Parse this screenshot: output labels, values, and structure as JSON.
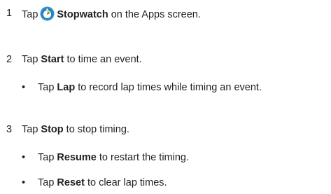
{
  "steps": [
    {
      "number": "1",
      "pre": "Tap",
      "icon": "stopwatch-app-icon",
      "bold": "Stopwatch",
      "post": " on the Apps screen.",
      "subs": []
    },
    {
      "number": "2",
      "pre": "Tap ",
      "bold": "Start",
      "post": " to time an event.",
      "subs": [
        {
          "bullet": "•",
          "pre": "Tap ",
          "bold": "Lap",
          "post": " to record lap times while timing an event."
        }
      ]
    },
    {
      "number": "3",
      "pre": "Tap ",
      "bold": "Stop",
      "post": " to stop timing.",
      "subs": [
        {
          "bullet": "•",
          "pre": "Tap ",
          "bold": "Resume",
          "post": " to restart the timing."
        },
        {
          "bullet": "•",
          "pre": "Tap ",
          "bold": "Reset",
          "post": " to clear lap times."
        }
      ]
    }
  ],
  "colors": {
    "text": "#231f20",
    "icon_blue": "#2f93d6",
    "icon_yellow": "#f5c400"
  }
}
